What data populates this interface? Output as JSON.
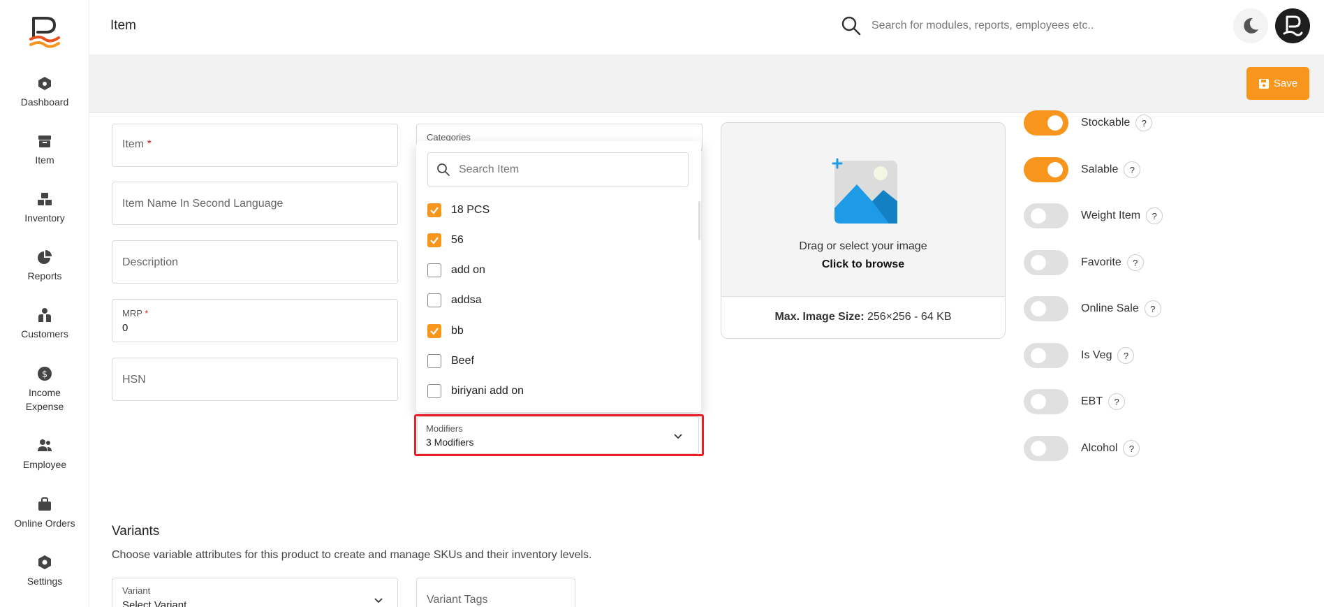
{
  "sidebar": {
    "items": [
      {
        "label": "Dashboard",
        "icon": "dashboard-icon"
      },
      {
        "label": "Item",
        "icon": "item-icon"
      },
      {
        "label": "Inventory",
        "icon": "inventory-icon"
      },
      {
        "label": "Reports",
        "icon": "reports-icon"
      },
      {
        "label": "Customers",
        "icon": "customers-icon"
      },
      {
        "label": "Income Expense",
        "icon": "income-expense-icon"
      },
      {
        "label": "Employee",
        "icon": "employee-icon"
      },
      {
        "label": "Online Orders",
        "icon": "online-orders-icon"
      },
      {
        "label": "Settings",
        "icon": "settings-icon"
      }
    ]
  },
  "header": {
    "title": "Item",
    "search_placeholder": "Search for modules, reports, employees etc.."
  },
  "toolbar": {
    "save_label": "Save"
  },
  "form": {
    "item_label": "Item",
    "item_required": "*",
    "second_language_label": "Item Name In Second Language",
    "description_label": "Description",
    "mrp_label": "MRP",
    "mrp_required": "*",
    "mrp_value": "0",
    "hsn_label": "HSN",
    "categories_label": "Categories"
  },
  "dropdown": {
    "search_placeholder": "Search Item",
    "options": [
      {
        "label": "18 PCS",
        "checked": true
      },
      {
        "label": "56",
        "checked": true
      },
      {
        "label": "add on",
        "checked": false
      },
      {
        "label": "addsa",
        "checked": false
      },
      {
        "label": "bb",
        "checked": true
      },
      {
        "label": "Beef",
        "checked": false
      },
      {
        "label": "biriyani add on",
        "checked": false
      }
    ]
  },
  "modifiers": {
    "label": "Modifiers",
    "value": "3 Modifiers"
  },
  "upload": {
    "line1": "Drag or select your image",
    "line2": "Click to browse",
    "size_label": "Max. Image Size:",
    "size_value": "256×256 - 64 KB"
  },
  "toggles": [
    {
      "label": "Stockable",
      "on": true
    },
    {
      "label": "Salable",
      "on": true
    },
    {
      "label": "Weight Item",
      "on": false
    },
    {
      "label": "Favorite",
      "on": false
    },
    {
      "label": "Online Sale",
      "on": false
    },
    {
      "label": "Is Veg",
      "on": false
    },
    {
      "label": "EBT",
      "on": false
    },
    {
      "label": "Alcohol",
      "on": false
    }
  ],
  "help_glyph": "?",
  "variants": {
    "title": "Variants",
    "description": "Choose variable attributes for this product to create and manage SKUs and their inventory levels.",
    "variant_label": "Variant",
    "variant_value": "Select Variant",
    "tags_label": "Variant Tags"
  },
  "colors": {
    "accent": "#f7951d",
    "highlight": "#ee1c25",
    "image_icon_blue": "#1d9be6"
  }
}
